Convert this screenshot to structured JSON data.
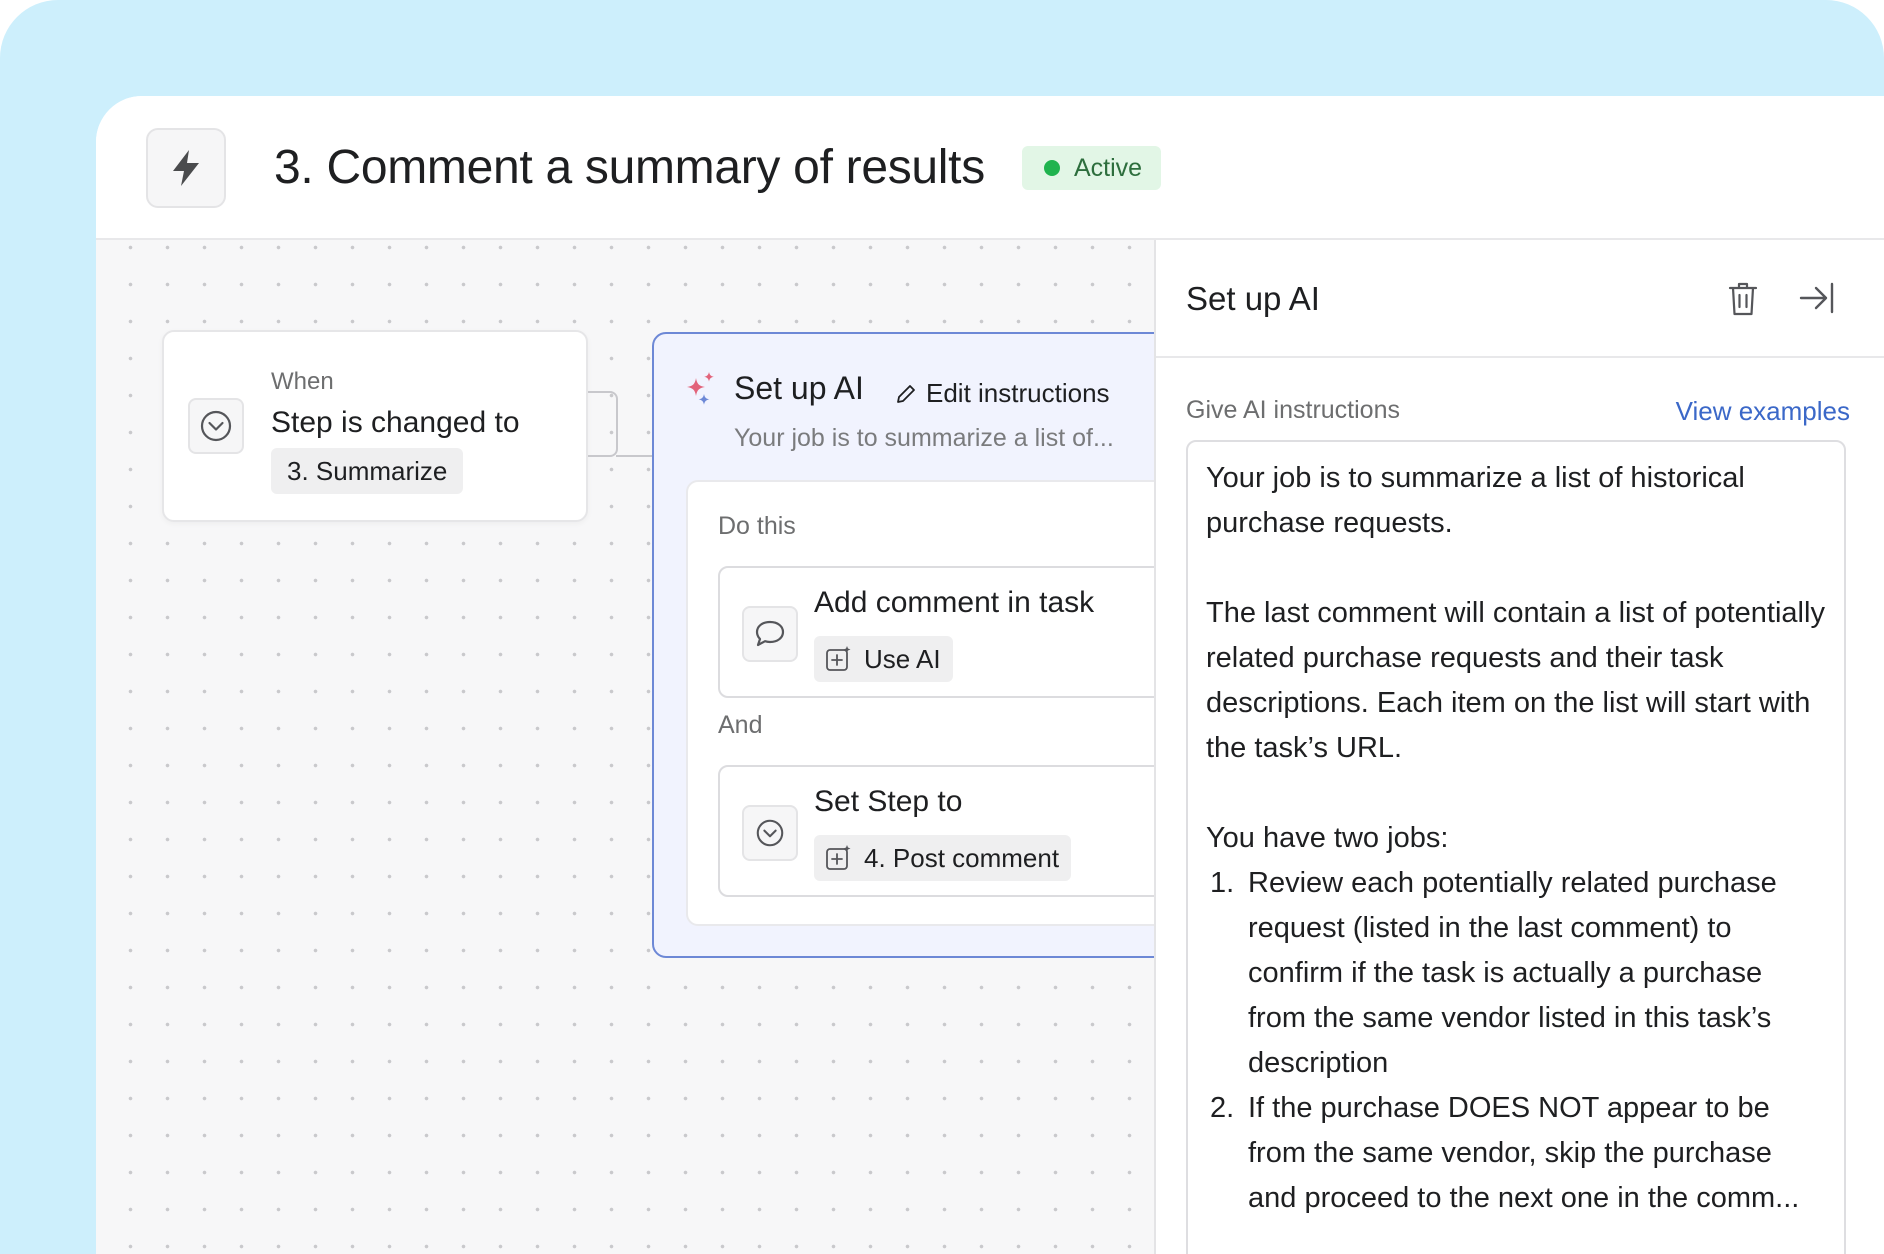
{
  "header": {
    "title": "3. Comment a summary of results",
    "status": "Active",
    "icon": "lightning-bolt-icon"
  },
  "canvas": {
    "trigger": {
      "when_label": "When",
      "title": "Step is changed to",
      "value": "3. Summarize",
      "icon": "chevron-down-circle-icon"
    },
    "ai_node": {
      "title": "Set up AI",
      "edit_label": "Edit instructions",
      "subtitle": "Your job is to summarize a list of...",
      "do_this_label": "Do this",
      "and_label": "And",
      "actions": [
        {
          "title": "Add comment in task",
          "chip": "Use AI",
          "icon": "comment-icon"
        },
        {
          "title": "Set Step to",
          "chip": "4. Post comment",
          "icon": "chevron-down-circle-icon"
        }
      ]
    }
  },
  "panel": {
    "title": "Set up AI",
    "instructions_label": "Give AI instructions",
    "view_examples": "View examples",
    "instructions": {
      "p1": "Your job is to summarize a list of historical purchase requests.",
      "p2": "The last comment will contain a list of potentially related purchase requests and their task descriptions. Each item on the list will start with the task’s URL.",
      "p3": "You have two jobs:",
      "items": [
        {
          "num": "1.",
          "text": "Review each potentially related purchase request (listed in the last comment) to confirm if the task is actually a purchase from the same vendor listed in this task’s description"
        },
        {
          "num": "2.",
          "text": "If the purchase DOES NOT appear to be from the same vendor, skip the purchase and proceed to the next one in the comm..."
        }
      ]
    }
  },
  "colors": {
    "backdrop": "#cdeffc",
    "accent_blue": "#3b68c8",
    "ai_border": "#6d88d6",
    "status_green": "#1fb34e"
  }
}
